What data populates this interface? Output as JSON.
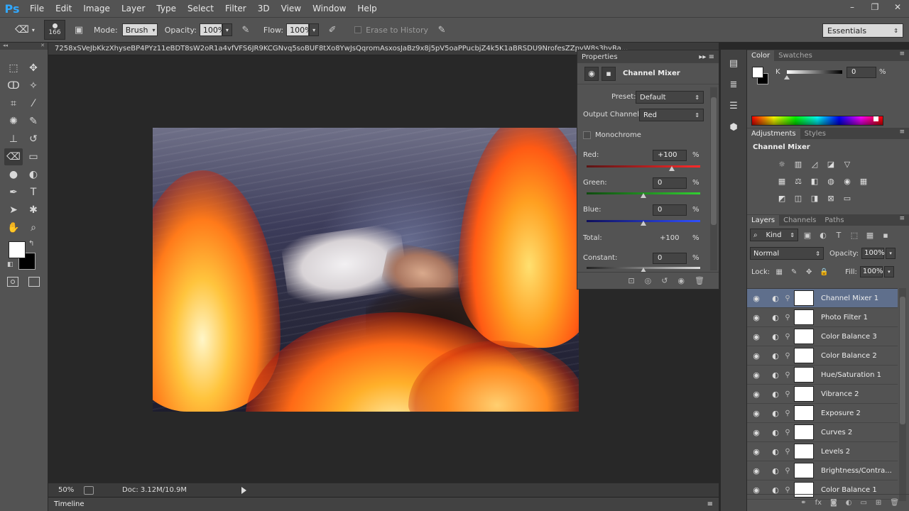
{
  "app": {
    "logo": "Ps"
  },
  "menu": [
    "File",
    "Edit",
    "Image",
    "Layer",
    "Type",
    "Select",
    "Filter",
    "3D",
    "View",
    "Window",
    "Help"
  ],
  "window_controls": [
    "–",
    "❐",
    "✕"
  ],
  "options": {
    "brush_size": "166",
    "mode_label": "Mode:",
    "mode_value": "Brush",
    "opacity_label": "Opacity:",
    "opacity_value": "100%",
    "flow_label": "Flow:",
    "flow_value": "100%",
    "erase_history_label": "Erase to History",
    "workspace": "Essentials"
  },
  "document": {
    "tab_title": "7258xSVeJbKkzXhyseBP4PYz11eBDT8sW2oR1a4vfVFS6JR9KCGNvq5soBUF8tXo8YwJsQqromAsxosJaBz9x8j5pV5oaPPucbjZ4k5K1aBRSDU9NrofesZZpvW8s3byRa...",
    "zoom": "50%",
    "doc_size": "Doc: 3.12M/10.9M"
  },
  "timeline": {
    "label": "Timeline"
  },
  "properties": {
    "panel_title": "Properties",
    "adjustment_name": "Channel Mixer",
    "preset_label": "Preset:",
    "preset_value": "Default",
    "output_label": "Output Channel:",
    "output_value": "Red",
    "monochrome_label": "Monochrome",
    "pct": "%",
    "sliders": [
      {
        "label": "Red:",
        "value": "+100",
        "fraction": 0.75,
        "track_from": "#5a1414",
        "track_to": "#ff2a2a"
      },
      {
        "label": "Green:",
        "value": "0",
        "fraction": 0.5,
        "track_from": "#0f4a0f",
        "track_to": "#32d032"
      },
      {
        "label": "Blue:",
        "value": "0",
        "fraction": 0.5,
        "track_from": "#0f0f5a",
        "track_to": "#3050ff"
      }
    ],
    "total_label": "Total:",
    "total_value": "+100",
    "constant_label": "Constant:",
    "constant_value": "0",
    "constant_fraction": 0.5
  },
  "color_panel": {
    "tabs": [
      "Color",
      "Swatches"
    ],
    "channel_label": "K",
    "k_value": "0",
    "pct": "%",
    "k_fraction": 0.0
  },
  "adjustments_panel": {
    "tabs": [
      "Adjustments",
      "Styles"
    ],
    "title": "Channel Mixer"
  },
  "layers_panel": {
    "tabs": [
      "Layers",
      "Channels",
      "Paths"
    ],
    "kind_label": "Kind",
    "blend_mode": "Normal",
    "opacity_label": "Opacity:",
    "opacity_value": "100%",
    "lock_label": "Lock:",
    "fill_label": "Fill:",
    "fill_value": "100%",
    "layers": [
      {
        "name": "Channel Mixer 1",
        "selected": true
      },
      {
        "name": "Photo Filter 1",
        "selected": false
      },
      {
        "name": "Color Balance 3",
        "selected": false
      },
      {
        "name": "Color Balance 2",
        "selected": false
      },
      {
        "name": "Hue/Saturation 1",
        "selected": false
      },
      {
        "name": "Vibrance 2",
        "selected": false
      },
      {
        "name": "Exposure 2",
        "selected": false
      },
      {
        "name": "Curves 2",
        "selected": false
      },
      {
        "name": "Levels 2",
        "selected": false
      },
      {
        "name": "Brightness/Contra...",
        "selected": false
      },
      {
        "name": "Color Balance 1",
        "selected": false
      }
    ]
  }
}
